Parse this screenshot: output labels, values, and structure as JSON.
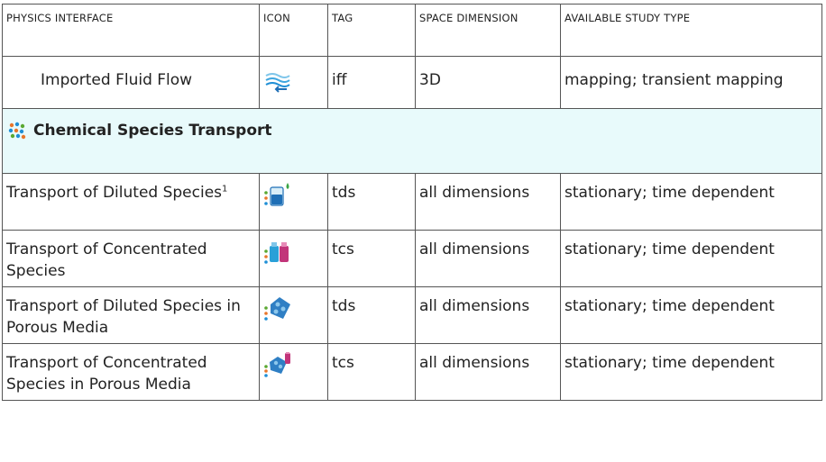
{
  "headers": {
    "physics_interface": "PHYSICS INTERFACE",
    "icon": "ICON",
    "tag": "TAG",
    "space_dimension": "SPACE DIMENSION",
    "study_type": "AVAILABLE STUDY TYPE"
  },
  "rows": [
    {
      "name": "Imported Fluid Flow",
      "icon": "imported-fluid-flow-icon",
      "tag": "iff",
      "dimension": "3D",
      "study": "mapping; transient mapping"
    },
    {
      "name": "Transport of Diluted Species",
      "footnote": "1",
      "icon": "diluted-species-icon",
      "tag": "tds",
      "dimension": "all dimensions",
      "study": "stationary; time dependent"
    },
    {
      "name": "Transport of Concentrated Species",
      "icon": "concentrated-species-icon",
      "tag": "tcs",
      "dimension": "all dimensions",
      "study": "stationary; time dependent"
    },
    {
      "name": "Transport of Diluted Species in Porous Media",
      "icon": "diluted-porous-icon",
      "tag": "tds",
      "dimension": "all dimensions",
      "study": "stationary; time dependent"
    },
    {
      "name": "Transport of Concentrated Species in Porous Media",
      "icon": "concentrated-porous-icon",
      "tag": "tcs",
      "dimension": "all dimensions",
      "study": "stationary; time dependent"
    }
  ],
  "section": {
    "title": "Chemical Species Transport",
    "icon": "chemical-species-icon"
  },
  "colors": {
    "section_bg": "#e8fafb",
    "border": "#555555",
    "accent_blue": "#1f8fd6",
    "accent_green": "#5aa832",
    "accent_orange": "#e8762b"
  }
}
